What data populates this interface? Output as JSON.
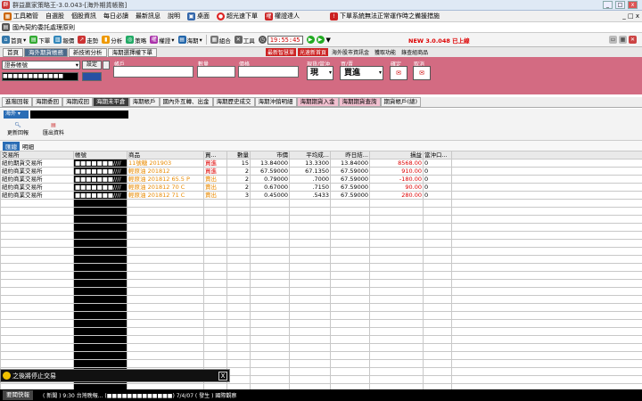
{
  "window": {
    "title": "群益贏家策略王-3.0.043-[海外期貨帳務]"
  },
  "menu": [
    "工具箱管",
    "自選股",
    "個股資訊",
    "每日必讀",
    "最新訊息",
    "說明",
    "桌面",
    "超光速下單",
    "權證達人",
    "下單系統無法正常運作時之備援措施"
  ],
  "instrument_bar": {
    "label": "國內契約委託處理原則"
  },
  "toolbar": {
    "items": [
      "首頁",
      "下單",
      "報價",
      "走勢",
      "分析",
      "策略",
      "權證",
      "海期",
      "組合",
      "工具"
    ],
    "clock": "19:55:45",
    "version": "NEW 3.0.048 已上線"
  },
  "tabs1": [
    "首頁",
    "海外期貨帳務",
    "新技術分析",
    "海期選擇權下單"
  ],
  "tabs1_active": 1,
  "promo": [
    "最新智慧單",
    "光速新首頁",
    "海外股市資訊金",
    "獲取功能",
    "錄查組商品"
  ],
  "order": {
    "account_label": "證券帳號",
    "set_button": "設定",
    "labels": [
      "帳戶",
      "數量",
      "價格",
      "現貨/當沖",
      "買/賣",
      "確定",
      "取消"
    ],
    "type_value": "現",
    "side_value": "買進"
  },
  "tabs2": [
    {
      "label": "進階回報",
      "style": ""
    },
    {
      "label": "海期委回",
      "style": ""
    },
    {
      "label": "海期成回",
      "style": ""
    },
    {
      "label": "海期未平倉",
      "style": "act"
    },
    {
      "label": "海期帳戶",
      "style": ""
    },
    {
      "label": "國內外互轉、出金",
      "style": ""
    },
    {
      "label": "海期歷史成交",
      "style": ""
    },
    {
      "label": "海期沖銷明細",
      "style": ""
    },
    {
      "label": "海期期貨入金",
      "style": "pink"
    },
    {
      "label": "海期期貨查詢",
      "style": "pink"
    },
    {
      "label": "期貨帳戶(總)",
      "style": ""
    }
  ],
  "subpanel": {
    "region": "海外",
    "buttons": [
      "更新回報",
      "匯出資料"
    ],
    "subtabs": [
      "匯總",
      "明細"
    ]
  },
  "grid": {
    "headers": [
      "交易所",
      "帳號",
      "商品",
      "買...",
      "數量",
      "市價",
      "平均成...",
      "昨日結...",
      "損益",
      "當沖口..."
    ],
    "rows": [
      {
        "exchange": "紐約期貨交易所",
        "account": "■■■■■■■////",
        "product": "11號糖 201903",
        "side": "買進",
        "qty": "15",
        "price": "13.84000",
        "avg": "13.3300",
        "settle": "13.84000",
        "pnl": "8568.00",
        "day": "0"
      },
      {
        "exchange": "紐約商業交易所",
        "account": "■■■■■■■////",
        "product": "輕原油 201812",
        "side": "買進",
        "qty": "2",
        "price": "67.59000",
        "avg": "67.1350",
        "settle": "67.59000",
        "pnl": "910.00",
        "day": "0"
      },
      {
        "exchange": "紐約商業交易所",
        "account": "■■■■■■■////",
        "product": "輕原油 201812 65.5 P",
        "side": "賣出",
        "qty": "2",
        "price": "0.79000",
        "avg": ".7000",
        "settle": "67.59000",
        "pnl": "-180.00",
        "day": "0"
      },
      {
        "exchange": "紐約商業交易所",
        "account": "■■■■■■■////",
        "product": "輕原油 201812 70 C",
        "side": "賣出",
        "qty": "2",
        "price": "0.67000",
        "avg": ".7150",
        "settle": "67.59000",
        "pnl": "90.00",
        "day": "0"
      },
      {
        "exchange": "紐約商業交易所",
        "account": "■■■■■■■////",
        "product": "輕原油 201812 71 C",
        "side": "賣出",
        "qty": "3",
        "price": "0.45000",
        "avg": ".5433",
        "settle": "67.59000",
        "pnl": "280.00",
        "day": "0"
      }
    ]
  },
  "popup": {
    "text": "之後將停止交易",
    "close": "X"
  },
  "status": {
    "label": "要聞快報",
    "text": "( 新聞 ) 9:30 台灣晚報...  (■■■■■■■■■■■■■) 7/4/07 ( 發生 ) 國際觀察"
  }
}
